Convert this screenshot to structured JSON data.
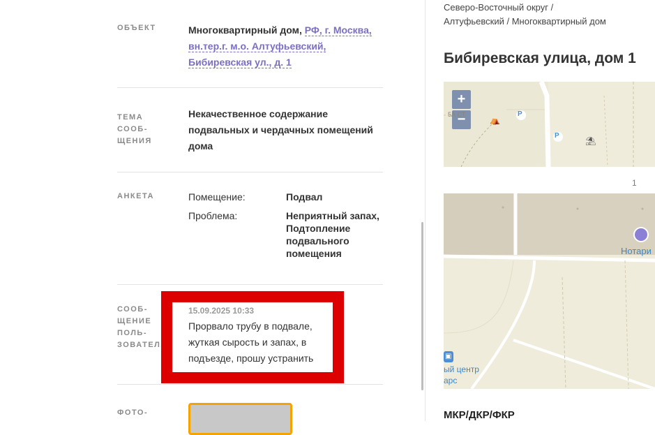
{
  "details": {
    "object_label": "ОБЪЕКТ",
    "object_prefix": "Многоквартирный дом,",
    "object_link_1": "РФ, г. Москва,",
    "object_link_2": "вн.тер.г. м.о. Алтуфьевский,",
    "object_link_3": "Бибиревская ул., д. 1",
    "topic_label_1": "ТЕМА",
    "topic_label_2": "СООБ-",
    "topic_label_3": "ЩЕНИЯ",
    "topic_line_1": "Некачественное содержание",
    "topic_line_2": "подвальных и чердачных помещений",
    "topic_line_3": "дома",
    "form_label": "АНКЕТА",
    "form_rows": [
      {
        "key": "Помещение:",
        "value_lines": [
          "Подвал"
        ]
      },
      {
        "key": "Проблема:",
        "value_lines": [
          "Неприятный запах,",
          "Подтопление",
          "подвального",
          "помещения"
        ]
      }
    ],
    "msg_label_1": "СООБ-",
    "msg_label_2": "ЩЕНИЕ",
    "msg_label_3": "ПОЛЬ-",
    "msg_label_4": "ЗОВАТЕЛЯ",
    "msg_date": "15.09.2025 10:33",
    "msg_line_1": "Прорвало трубу в подвале,",
    "msg_line_2": "жуткая сырость и запах, в",
    "msg_line_3": "подъезде, прошу устранить",
    "photo_label": "ФОТО-"
  },
  "sidebar": {
    "breadcrumb_1": "Северо-Восточный округ /",
    "breadcrumb_2": "Алтуфьевский / Многоквартирный дом",
    "address": "Бибиревская улица, дом 1",
    "map": {
      "zoom_in": "+",
      "zoom_out": "−",
      "house_number": "1",
      "poi_notary": "Нотари",
      "poi_center": "ый центр",
      "poi_mars": "арс",
      "parking_1": "P",
      "parking_2": "P",
      "scale_text": "5А СТ"
    },
    "section_title": "МКР/ДКР/ФКР"
  },
  "colors": {
    "accent_link": "#7b6fc4",
    "highlight_border": "#dd0000",
    "photo_border": "#f5a300",
    "map_pin": "#8b7fd6"
  }
}
